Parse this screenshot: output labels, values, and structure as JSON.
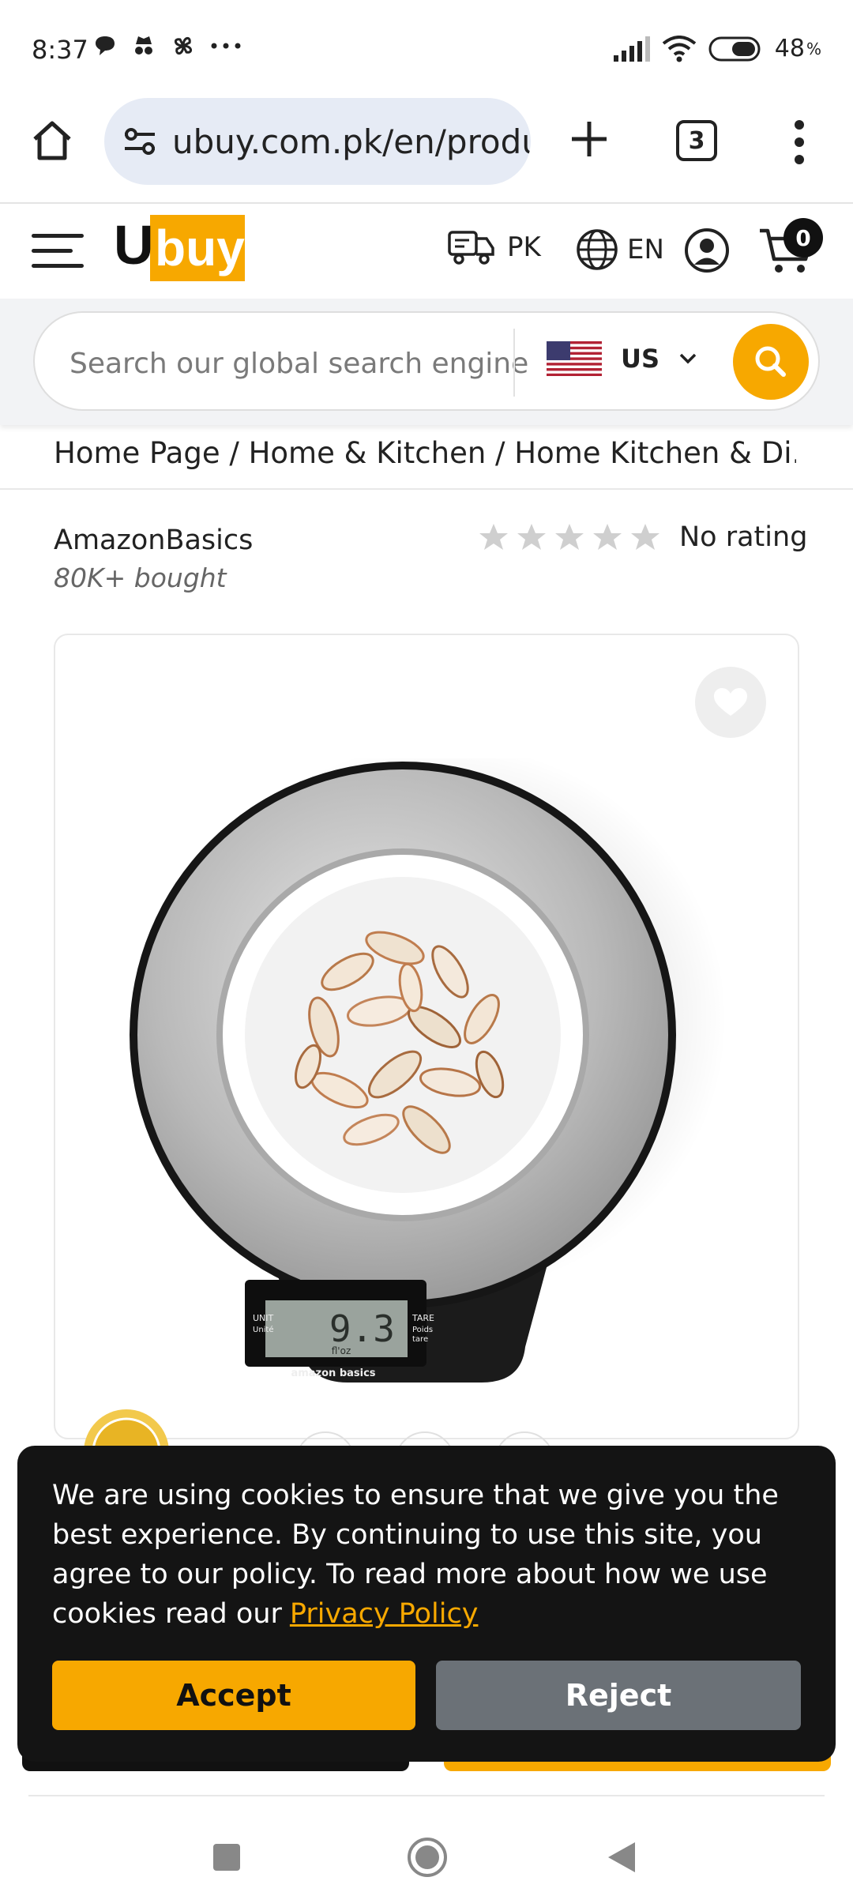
{
  "status_bar": {
    "time": "8:37",
    "icons": [
      "chat-bubble-icon",
      "incognito-icon",
      "pinwheel-icon",
      "more-dots-icon"
    ],
    "right_icons": [
      "signal-icon",
      "wifi-icon",
      "battery-icon"
    ],
    "battery": "48"
  },
  "browser": {
    "url": "ubuy.com.pk/en/product",
    "tab_count": "3"
  },
  "header": {
    "logo_text": "Ubuy",
    "ship_to": "PK",
    "language": "EN",
    "cart_count": "0"
  },
  "search": {
    "placeholder": "Search our global search engine",
    "country": "US"
  },
  "breadcrumb": "Home Page / Home & Kitchen / Home Kitchen & Di...",
  "product": {
    "brand": "AmazonBasics",
    "bought": "80K+ bought",
    "rating_text": "No rating",
    "stars_filled": 0,
    "stars_total": 5,
    "scale_display": "9.3",
    "scale_unit": "fl'oz",
    "scale_brand": "amazon basics",
    "scale_left_label": "UNIT",
    "scale_left_label2": "Unité",
    "scale_right_label": "TARE",
    "scale_right_label2": "Poids",
    "scale_right_label3": "tare"
  },
  "cookie": {
    "text": "We are using cookies to ensure that we give you the best experience. By continuing to use this site, you agree to our policy. To read more about how we use cookies read our",
    "link": "Privacy Policy",
    "accept": "Accept",
    "reject": "Reject"
  },
  "colors": {
    "accent": "#f7a800",
    "dark": "#141414",
    "reject_gray": "#6b7177"
  }
}
